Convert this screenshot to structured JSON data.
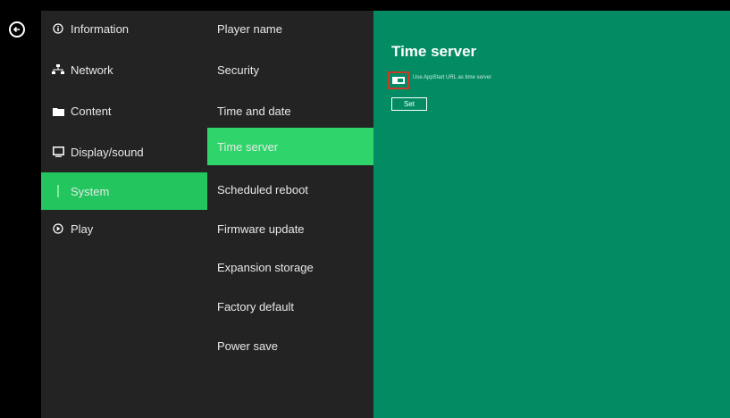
{
  "colors": {
    "background": "#000000",
    "panel": "#232323",
    "accent_green": "#22c55e",
    "content_green": "#038c63",
    "highlight_outline": "#c83a2a"
  },
  "back_button": {
    "icon": "arrow-left-circle-icon"
  },
  "menu": {
    "items": [
      {
        "label": "Information",
        "icon": "info-circle-icon"
      },
      {
        "label": "Network",
        "icon": "network-icon"
      },
      {
        "label": "Content",
        "icon": "folder-icon"
      },
      {
        "label": "Display/sound",
        "icon": "monitor-icon"
      },
      {
        "label": "System",
        "icon": "system-icon",
        "active": true
      },
      {
        "label": "Play",
        "icon": "play-circle-icon"
      }
    ]
  },
  "submenu": {
    "items": [
      {
        "label": "Player name"
      },
      {
        "label": "Security"
      },
      {
        "label": "Time and date"
      },
      {
        "label": "Time server",
        "active": true
      },
      {
        "label": "Scheduled reboot"
      },
      {
        "label": "Firmware update"
      },
      {
        "label": "Expansion storage"
      },
      {
        "label": "Factory default"
      },
      {
        "label": "Power save"
      }
    ]
  },
  "content": {
    "title": "Time server",
    "option_label": "Use AppStart URL as time server",
    "set_label": "Set"
  }
}
